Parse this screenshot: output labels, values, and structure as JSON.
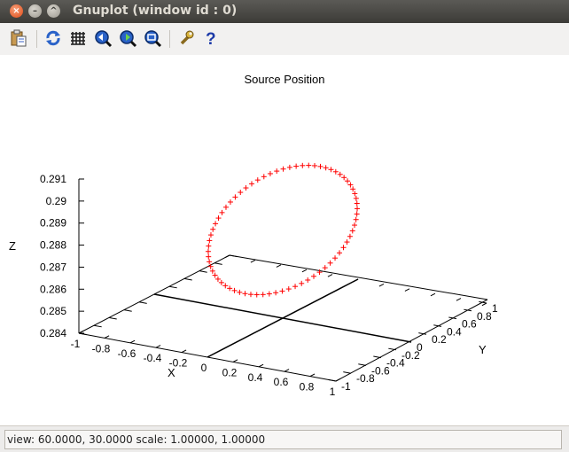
{
  "window": {
    "title": "Gnuplot (window id : 0)",
    "close_glyph": "×",
    "minimize_glyph": "–",
    "maximize_glyph": "^"
  },
  "toolbar": {
    "items": [
      {
        "name": "copy-clipboard",
        "icon": "clipboard-icon"
      },
      {
        "name": "replot",
        "icon": "refresh-icon"
      },
      {
        "name": "toggle-grid",
        "icon": "grid-icon"
      },
      {
        "name": "zoom-previous",
        "icon": "zoom-previous-icon"
      },
      {
        "name": "zoom-next",
        "icon": "zoom-next-icon"
      },
      {
        "name": "unzoom",
        "icon": "zoom-fit-icon"
      },
      {
        "name": "preferences",
        "icon": "wrench-icon"
      },
      {
        "name": "help",
        "icon": "help-icon"
      }
    ]
  },
  "chart_data": {
    "type": "scatter",
    "title": "Source Position",
    "xlabel": "X",
    "ylabel": "Y",
    "zlabel": "Z",
    "xlim": [
      -1,
      1
    ],
    "ylim": [
      -1,
      1
    ],
    "zlim": [
      0.284,
      0.291
    ],
    "x_ticks": [
      "-1",
      "-0.8",
      "-0.6",
      "-0.4",
      "-0.2",
      "0",
      "0.2",
      "0.4",
      "0.6",
      "0.8",
      "1"
    ],
    "y_ticks": [
      "-1",
      "-0.8",
      "-0.6",
      "-0.4",
      "-0.2",
      "0",
      "0.2",
      "0.4",
      "0.6",
      "0.8",
      "1"
    ],
    "z_ticks": [
      "0.284",
      "0.285",
      "0.286",
      "0.287",
      "0.288",
      "0.289",
      "0.29",
      "0.291"
    ],
    "series": [
      {
        "color": "#ff0000",
        "marker": "plus",
        "shape": "circle",
        "center": [
          0,
          0,
          0.288
        ],
        "radius": 0.5,
        "z_amplitude": 0.002,
        "points": 72
      }
    ],
    "grid": false,
    "view": [
      60,
      30
    ]
  },
  "status": {
    "text": "view:  60.0000,  30.0000   scale:  1.00000,  1.00000"
  }
}
